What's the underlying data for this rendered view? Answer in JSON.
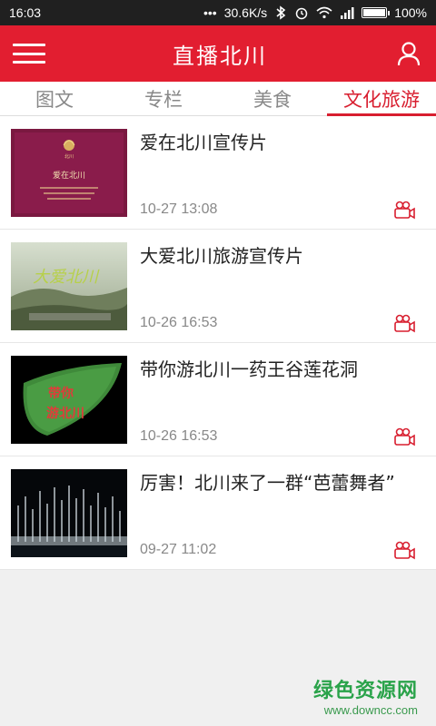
{
  "status_bar": {
    "time": "16:03",
    "network_speed": "30.6K/s",
    "battery_text": "100%",
    "battery_level": 1.0
  },
  "header": {
    "title": "直播北川",
    "menu_icon": "hamburger-menu-icon",
    "user_icon": "user-profile-icon"
  },
  "tabs": [
    {
      "label": "图文",
      "active": false
    },
    {
      "label": "专栏",
      "active": false
    },
    {
      "label": "美食",
      "active": false
    },
    {
      "label": "文化旅游",
      "active": true
    }
  ],
  "list": {
    "items": [
      {
        "title": "爱在北川宣传片",
        "time": "10-27 13:08",
        "thumb_text": "爱在北川"
      },
      {
        "title": "大爱北川旅游宣传片",
        "time": "10-26 16:53",
        "thumb_text": "大爱北川"
      },
      {
        "title": "带你游北川一药王谷莲花洞",
        "time": "10-26 16:53",
        "thumb_text_1": "带你",
        "thumb_text_2": "游北川"
      },
      {
        "title": "厉害！北川来了一群“芭蕾舞者”",
        "time": "09-27 11:02"
      }
    ],
    "item_icon": "video-camera-icon"
  },
  "watermark": {
    "main": "绿色资源网",
    "sub": "www.downcc.com"
  },
  "colors": {
    "brand_red": "#e21e30",
    "active_tab": "#d81e2f",
    "watermark_green": "#2aa34a"
  }
}
